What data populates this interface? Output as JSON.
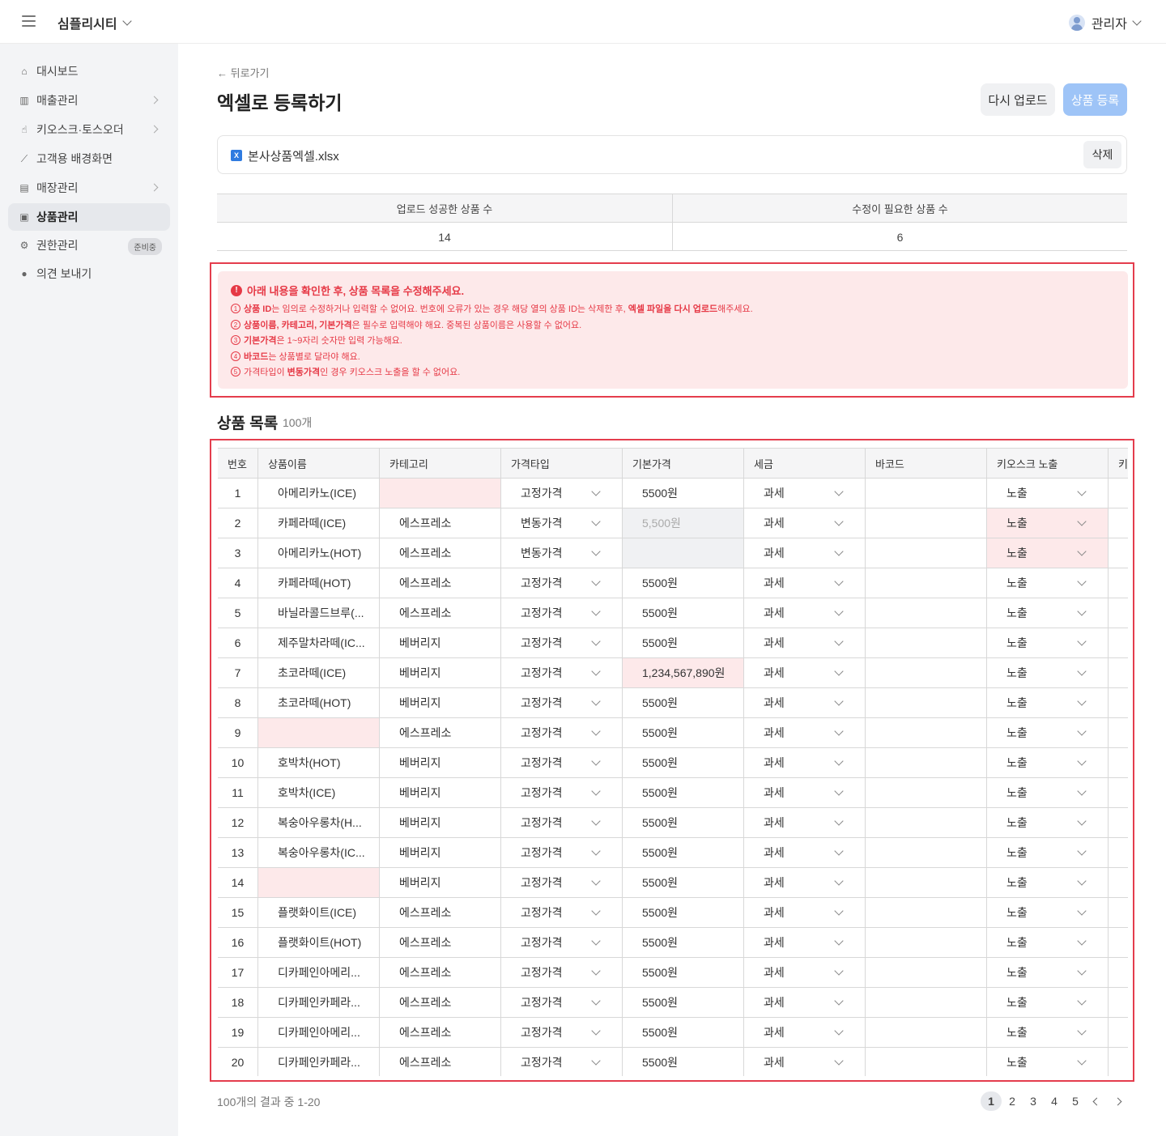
{
  "app": {
    "brand": "심플리시티",
    "user": "관리자"
  },
  "sidebar": {
    "items": [
      {
        "label": "대시보드",
        "icon": "home-icon",
        "arrow": false
      },
      {
        "label": "매출관리",
        "icon": "bar-chart-icon",
        "arrow": true
      },
      {
        "label": "키오스크·토스오더",
        "icon": "hand-pointer-icon",
        "arrow": true
      },
      {
        "label": "고객용 배경화면",
        "icon": "brush-icon",
        "arrow": false
      },
      {
        "label": "매장관리",
        "icon": "store-icon",
        "arrow": true
      },
      {
        "label": "상품관리",
        "icon": "product-icon",
        "arrow": false,
        "active": true
      },
      {
        "label": "권한관리",
        "icon": "gear-icon",
        "arrow": false,
        "badge": "준비중"
      },
      {
        "label": "의견 보내기",
        "icon": "chat-bubble-icon",
        "arrow": false
      }
    ]
  },
  "page": {
    "back": "← 뒤로가기",
    "title": "엑셀로 등록하기",
    "reupload": "다시 업로드",
    "register": "상품 등록",
    "file_name": "본사상품엑셀.xlsx",
    "file_delete": "삭제"
  },
  "summary": {
    "success_label": "업로드 성공한 상품 수",
    "success_value": "14",
    "fix_label": "수정이 필요한 상품 수",
    "fix_value": "6"
  },
  "warning": {
    "title": "아래 내용을 확인한 후, 상품 목록을 수정해주세요.",
    "lines": [
      {
        "num": "1",
        "parts": [
          [
            "b",
            "상품 ID"
          ],
          [
            "t",
            "는 임의로 수정하거나 입력할 수 없어요. 번호에 오류가 있는 경우 해당 열의 상품 ID는 삭제한 후, "
          ],
          [
            "b",
            "엑셀 파일을 다시 업로드"
          ],
          [
            "t",
            "해주세요."
          ]
        ]
      },
      {
        "num": "2",
        "parts": [
          [
            "b",
            "상품이름, 카테고리, 기본가격"
          ],
          [
            "t",
            "은 필수로 입력해야 해요. 중복된 상품이름은 사용할 수 없어요."
          ]
        ]
      },
      {
        "num": "3",
        "parts": [
          [
            "b",
            "기본가격"
          ],
          [
            "t",
            "은 1~9자리 숫자만 입력 가능해요."
          ]
        ]
      },
      {
        "num": "4",
        "parts": [
          [
            "b",
            "바코드"
          ],
          [
            "t",
            "는 상품별로 달라야 해요."
          ]
        ]
      },
      {
        "num": "5",
        "parts": [
          [
            "t",
            "가격타입이 "
          ],
          [
            "b",
            "변동가격"
          ],
          [
            "t",
            "인 경우 키오스크 노출을 할 수 없어요."
          ]
        ]
      }
    ]
  },
  "list": {
    "title": "상품 목록",
    "count": "100개",
    "columns": [
      "번호",
      "상품이름",
      "카테고리",
      "가격타입",
      "기본가격",
      "세금",
      "바코드",
      "키오스크 노출",
      "키"
    ],
    "rows": [
      {
        "no": "1",
        "name": "아메리카노(ICE)",
        "cat": "",
        "type": "고정가격",
        "price": "5500원",
        "tax": "과세",
        "barcode": "",
        "kiosk": "노출",
        "err": [
          "cat"
        ]
      },
      {
        "no": "2",
        "name": "카페라떼(ICE)",
        "cat": "에스프레소",
        "type": "변동가격",
        "price": "5,500원",
        "tax": "과세",
        "barcode": "",
        "kiosk": "노출",
        "err": [
          "kiosk"
        ],
        "dis": [
          "price"
        ]
      },
      {
        "no": "3",
        "name": "아메리카노(HOT)",
        "cat": "에스프레소",
        "type": "변동가격",
        "price": "",
        "tax": "과세",
        "barcode": "",
        "kiosk": "노출",
        "err": [
          "kiosk"
        ],
        "dis": [
          "price"
        ]
      },
      {
        "no": "4",
        "name": "카페라떼(HOT)",
        "cat": "에스프레소",
        "type": "고정가격",
        "price": "5500원",
        "tax": "과세",
        "barcode": "",
        "kiosk": "노출",
        "err": []
      },
      {
        "no": "5",
        "name": "바닐라콜드브루(...",
        "cat": "에스프레소",
        "type": "고정가격",
        "price": "5500원",
        "tax": "과세",
        "barcode": "",
        "kiosk": "노출",
        "err": []
      },
      {
        "no": "6",
        "name": "제주말차라떼(IC...",
        "cat": "베버리지",
        "type": "고정가격",
        "price": "5500원",
        "tax": "과세",
        "barcode": "",
        "kiosk": "노출",
        "err": []
      },
      {
        "no": "7",
        "name": "초코라떼(ICE)",
        "cat": "베버리지",
        "type": "고정가격",
        "price": "1,234,567,890원",
        "tax": "과세",
        "barcode": "",
        "kiosk": "노출",
        "err": [
          "price"
        ]
      },
      {
        "no": "8",
        "name": "초코라떼(HOT)",
        "cat": "베버리지",
        "type": "고정가격",
        "price": "5500원",
        "tax": "과세",
        "barcode": "",
        "kiosk": "노출",
        "err": []
      },
      {
        "no": "9",
        "name": "",
        "cat": "에스프레소",
        "type": "고정가격",
        "price": "5500원",
        "tax": "과세",
        "barcode": "",
        "kiosk": "노출",
        "err": [
          "name"
        ]
      },
      {
        "no": "10",
        "name": "호박차(HOT)",
        "cat": "베버리지",
        "type": "고정가격",
        "price": "5500원",
        "tax": "과세",
        "barcode": "",
        "kiosk": "노출",
        "err": []
      },
      {
        "no": "11",
        "name": "호박차(ICE)",
        "cat": "베버리지",
        "type": "고정가격",
        "price": "5500원",
        "tax": "과세",
        "barcode": "",
        "kiosk": "노출",
        "err": []
      },
      {
        "no": "12",
        "name": "복숭아우롱차(H...",
        "cat": "베버리지",
        "type": "고정가격",
        "price": "5500원",
        "tax": "과세",
        "barcode": "",
        "kiosk": "노출",
        "err": []
      },
      {
        "no": "13",
        "name": "복숭아우롱차(IC...",
        "cat": "베버리지",
        "type": "고정가격",
        "price": "5500원",
        "tax": "과세",
        "barcode": "",
        "kiosk": "노출",
        "err": []
      },
      {
        "no": "14",
        "name": "",
        "cat": "베버리지",
        "type": "고정가격",
        "price": "5500원",
        "tax": "과세",
        "barcode": "",
        "kiosk": "노출",
        "err": [
          "name"
        ]
      },
      {
        "no": "15",
        "name": "플랫화이트(ICE)",
        "cat": "에스프레소",
        "type": "고정가격",
        "price": "5500원",
        "tax": "과세",
        "barcode": "",
        "kiosk": "노출",
        "err": []
      },
      {
        "no": "16",
        "name": "플랫화이트(HOT)",
        "cat": "에스프레소",
        "type": "고정가격",
        "price": "5500원",
        "tax": "과세",
        "barcode": "",
        "kiosk": "노출",
        "err": []
      },
      {
        "no": "17",
        "name": "디카페인아메리...",
        "cat": "에스프레소",
        "type": "고정가격",
        "price": "5500원",
        "tax": "과세",
        "barcode": "",
        "kiosk": "노출",
        "err": []
      },
      {
        "no": "18",
        "name": "디카페인카페라...",
        "cat": "에스프레소",
        "type": "고정가격",
        "price": "5500원",
        "tax": "과세",
        "barcode": "",
        "kiosk": "노출",
        "err": []
      },
      {
        "no": "19",
        "name": "디카페인아메리...",
        "cat": "에스프레소",
        "type": "고정가격",
        "price": "5500원",
        "tax": "과세",
        "barcode": "",
        "kiosk": "노출",
        "err": []
      },
      {
        "no": "20",
        "name": "디카페인카페라...",
        "cat": "에스프레소",
        "type": "고정가격",
        "price": "5500원",
        "tax": "과세",
        "barcode": "",
        "kiosk": "노출",
        "err": []
      }
    ]
  },
  "pagination": {
    "info": "100개의 결과 중 1-20",
    "pages": [
      "1",
      "2",
      "3",
      "4",
      "5"
    ],
    "current": "1"
  }
}
